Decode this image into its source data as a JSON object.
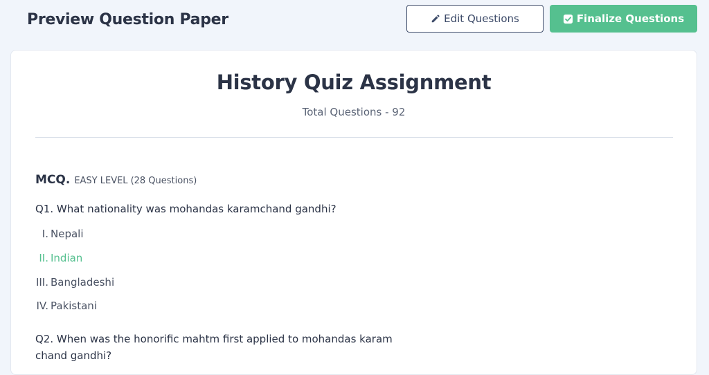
{
  "header": {
    "title": "Preview Question Paper",
    "edit_label": "Edit Questions",
    "finalize_label": "Finalize Questions"
  },
  "paper": {
    "title": "History Quiz Assignment",
    "total": "Total Questions - 92"
  },
  "section": {
    "type": "MCQ.",
    "level": "EASY LEVEL",
    "count": "(28 Questions)"
  },
  "questions": [
    {
      "text": "Q1. What nationality was mohandas karamchand gandhi?",
      "options": [
        {
          "num": "I.",
          "text": "Nepali"
        },
        {
          "num": "II.",
          "text": "Indian"
        },
        {
          "num": "III.",
          "text": "Bangladeshi"
        },
        {
          "num": "IV.",
          "text": "Pakistani"
        }
      ],
      "correct_index": 1
    },
    {
      "text": "Q2. When was the honorific mahtm first applied to mohandas karam chand gandhi?"
    }
  ],
  "colors": {
    "accent": "#55c08f",
    "dark": "#2b3346",
    "border": "#3c4a68",
    "background": "#f1f5fb"
  },
  "icons": {
    "edit": "pencil-icon",
    "finalize": "check-square-icon"
  }
}
